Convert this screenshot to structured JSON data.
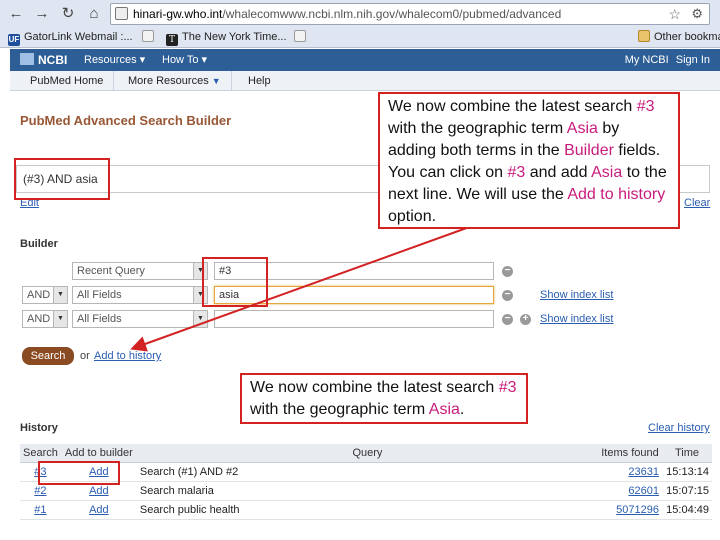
{
  "browser": {
    "url_host": "hinari-gw.who.int",
    "url_path": "/whalecomwww.ncbi.nlm.nih.gov/whalecom0/pubmed/advanced",
    "bookmarks": [
      {
        "label": "GatorLink Webmail :...",
        "icon": "uf-icon"
      },
      {
        "label": "",
        "icon": "globe-icon"
      },
      {
        "label": "The New York Time...",
        "icon": "nyt-icon"
      },
      {
        "label": "",
        "icon": "globe-icon"
      }
    ],
    "other_bookmarks": "Other bookmarks"
  },
  "ncbi": {
    "logo": "NCBI",
    "resources": "Resources",
    "how_to": "How To",
    "my_ncbi": "My NCBI",
    "sign_in": "Sign In"
  },
  "subnav": {
    "home": "PubMed Home",
    "more": "More Resources",
    "help": "Help"
  },
  "page": {
    "title": "PubMed Advanced Search Builder",
    "query": "(#3) AND asia",
    "edit": "Edit",
    "clear": "Clear"
  },
  "builder": {
    "label": "Builder",
    "rows": [
      {
        "op": "",
        "field": "Recent Query",
        "value": "#3",
        "show_index": ""
      },
      {
        "op": "AND",
        "field": "All Fields",
        "value": "asia",
        "show_index": "Show index list"
      },
      {
        "op": "AND",
        "field": "All Fields",
        "value": "",
        "show_index": "Show index list"
      }
    ],
    "search": "Search",
    "or": "or",
    "add_to_history": "Add to history"
  },
  "history": {
    "label": "History",
    "clear": "Clear history",
    "columns": [
      "Search",
      "Add to builder",
      "Query",
      "Items found",
      "Time"
    ],
    "rows": [
      {
        "search": "#3",
        "add": "Add",
        "query": "Search (#1) AND #2",
        "items": "23631",
        "time": "15:13:14"
      },
      {
        "search": "#2",
        "add": "Add",
        "query": "Search malaria",
        "items": "62601",
        "time": "15:07:15"
      },
      {
        "search": "#1",
        "add": "Add",
        "query": "Search public health",
        "items": "5071296",
        "time": "15:04:49"
      }
    ]
  },
  "annotations": {
    "top": {
      "p1": "We now combine the latest search ",
      "h1": "#3",
      "p2": " with the geographic term ",
      "h2": "Asia",
      "p3": " by adding both terms in the ",
      "h3": "Builder",
      "p4": " fields. You can click on ",
      "h4": "#3",
      "p5": " and add ",
      "h5": "Asia",
      "p6": " to the next line.  We will use the ",
      "h6": "Add to history",
      "p7": " option."
    },
    "bottom": {
      "p1": "We now combine the latest search ",
      "h1": "#3",
      "p2": " with the geographic term  ",
      "h2": "Asia",
      "p3": "."
    }
  },
  "colors": {
    "highlight": "#d32222",
    "accent_text": "#c81c7d",
    "ncbi_blue": "#2d5e96",
    "title_brown": "#985735"
  }
}
